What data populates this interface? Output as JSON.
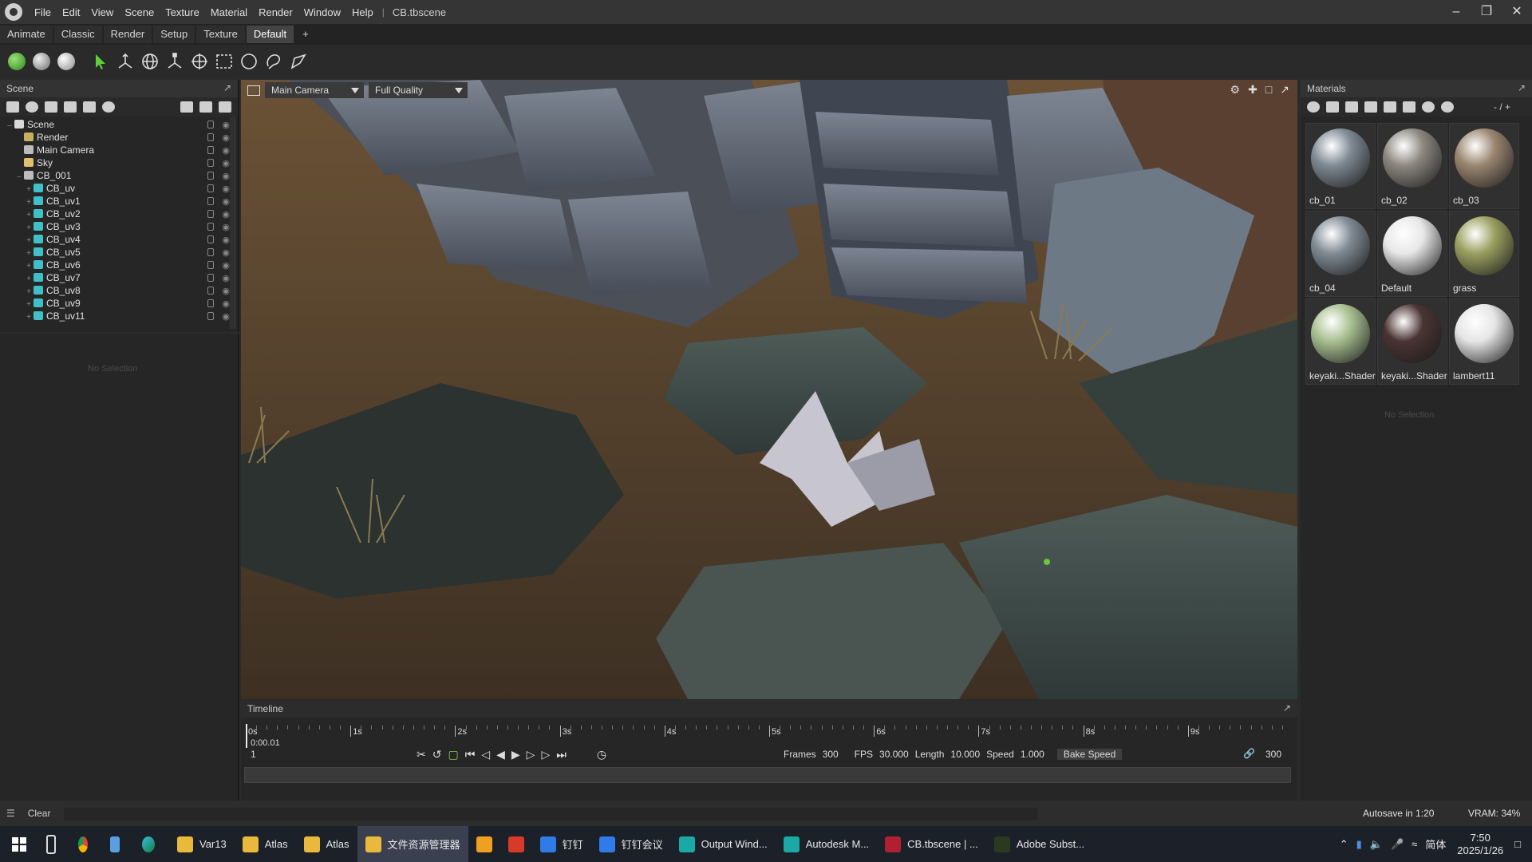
{
  "app": {
    "menu": [
      "File",
      "Edit",
      "View",
      "Scene",
      "Texture",
      "Material",
      "Render",
      "Window",
      "Help"
    ],
    "separator": "|",
    "file_name": "CB.tbscene"
  },
  "tabs": [
    "Animate",
    "Classic",
    "Render",
    "Setup",
    "Texture",
    "Default",
    "+"
  ],
  "toolbar": {
    "icons": [
      "sphere-green-icon",
      "sphere-gray-icon",
      "sphere-white-icon",
      "select-arrow-icon",
      "move-icon",
      "rotate-icon",
      "scale-icon",
      "transform-icon",
      "rect-select-icon",
      "circle-select-icon",
      "lasso-icon",
      "paint-select-icon"
    ]
  },
  "scene_panel": {
    "title": "Scene",
    "tree": [
      {
        "label": "Scene",
        "level": 0,
        "expander": "–",
        "icon_color": "#d8d8d8"
      },
      {
        "label": "Render",
        "level": 1,
        "expander": "",
        "icon_color": "#c8b060"
      },
      {
        "label": "Main Camera",
        "level": 1,
        "expander": "",
        "icon_color": "#bbbbbb"
      },
      {
        "label": "Sky",
        "level": 1,
        "expander": "",
        "icon_color": "#e0c070"
      },
      {
        "label": "CB_001",
        "level": 1,
        "expander": "–",
        "icon_color": "#bdbdbd"
      },
      {
        "label": "CB_uv",
        "level": 2,
        "expander": "+",
        "icon_color": "#3fc0c8"
      },
      {
        "label": "CB_uv1",
        "level": 2,
        "expander": "+",
        "icon_color": "#3fc0c8"
      },
      {
        "label": "CB_uv2",
        "level": 2,
        "expander": "+",
        "icon_color": "#3fc0c8"
      },
      {
        "label": "CB_uv3",
        "level": 2,
        "expander": "+",
        "icon_color": "#3fc0c8"
      },
      {
        "label": "CB_uv4",
        "level": 2,
        "expander": "+",
        "icon_color": "#3fc0c8"
      },
      {
        "label": "CB_uv5",
        "level": 2,
        "expander": "+",
        "icon_color": "#3fc0c8"
      },
      {
        "label": "CB_uv6",
        "level": 2,
        "expander": "+",
        "icon_color": "#3fc0c8"
      },
      {
        "label": "CB_uv7",
        "level": 2,
        "expander": "+",
        "icon_color": "#3fc0c8"
      },
      {
        "label": "CB_uv8",
        "level": 2,
        "expander": "+",
        "icon_color": "#3fc0c8"
      },
      {
        "label": "CB_uv9",
        "level": 2,
        "expander": "+",
        "icon_color": "#3fc0c8"
      },
      {
        "label": "CB_uv11",
        "level": 2,
        "expander": "+",
        "icon_color": "#3fc0c8"
      }
    ],
    "no_selection": "No Selection"
  },
  "viewport": {
    "camera": "Main Camera",
    "quality": "Full Quality"
  },
  "timeline": {
    "title": "Timeline",
    "ticks": [
      "0s",
      "1s",
      "2s",
      "3s",
      "4s",
      "5s",
      "6s",
      "7s",
      "8s",
      "9s"
    ],
    "current_time": "0:00.01",
    "current_frame": "1",
    "frames_label": "Frames",
    "frames": "300",
    "fps_label": "FPS",
    "fps": "30.000",
    "length_label": "Length",
    "length": "10.000",
    "speed_label": "Speed",
    "speed": "1.000",
    "bake_speed": "Bake Speed",
    "end_frame": "300"
  },
  "materials": {
    "title": "Materials",
    "counter": "- / +",
    "items": [
      {
        "name": "cb_01",
        "color": "#7f8a94"
      },
      {
        "name": "cb_02",
        "color": "#8c8880"
      },
      {
        "name": "cb_03",
        "color": "#9a8670"
      },
      {
        "name": "cb_04",
        "color": "#808b95"
      },
      {
        "name": "Default",
        "color": "#e8e8e8"
      },
      {
        "name": "grass",
        "color": "#9aa060"
      },
      {
        "name": "keyaki...Shader",
        "color": "#a8c090"
      },
      {
        "name": "keyaki...Shader",
        "color": "#4a3433"
      },
      {
        "name": "lambert11",
        "color": "#e6e6e6"
      }
    ],
    "no_selection": "No Selection"
  },
  "statusbar": {
    "clear": "Clear",
    "autosave": "Autosave in 1:20",
    "vram": "VRAM: 34%"
  },
  "taskbar": {
    "items": [
      {
        "label": "Var13",
        "color": "#e8b93b"
      },
      {
        "label": "Atlas",
        "color": "#e8b93b"
      },
      {
        "label": "Atlas",
        "color": "#e8b93b"
      },
      {
        "label": "文件资源管理器",
        "color": "#e8b93b"
      },
      {
        "label": "",
        "color": "#f0a020"
      },
      {
        "label": "",
        "color": "#d83a2a"
      },
      {
        "label": "钉钉",
        "color": "#2f7be8"
      },
      {
        "label": "钉钉会议",
        "color": "#2f7be8"
      },
      {
        "label": "Output Wind...",
        "color": "#1aa9a5"
      },
      {
        "label": "Autodesk M...",
        "color": "#1aa9a5"
      },
      {
        "label": "CB.tbscene | ...",
        "color": "#b02030"
      },
      {
        "label": "Adobe Subst...",
        "color": "#2a3a20"
      }
    ],
    "ime": "简体",
    "time": "7:50",
    "date": "2025/1/26"
  }
}
